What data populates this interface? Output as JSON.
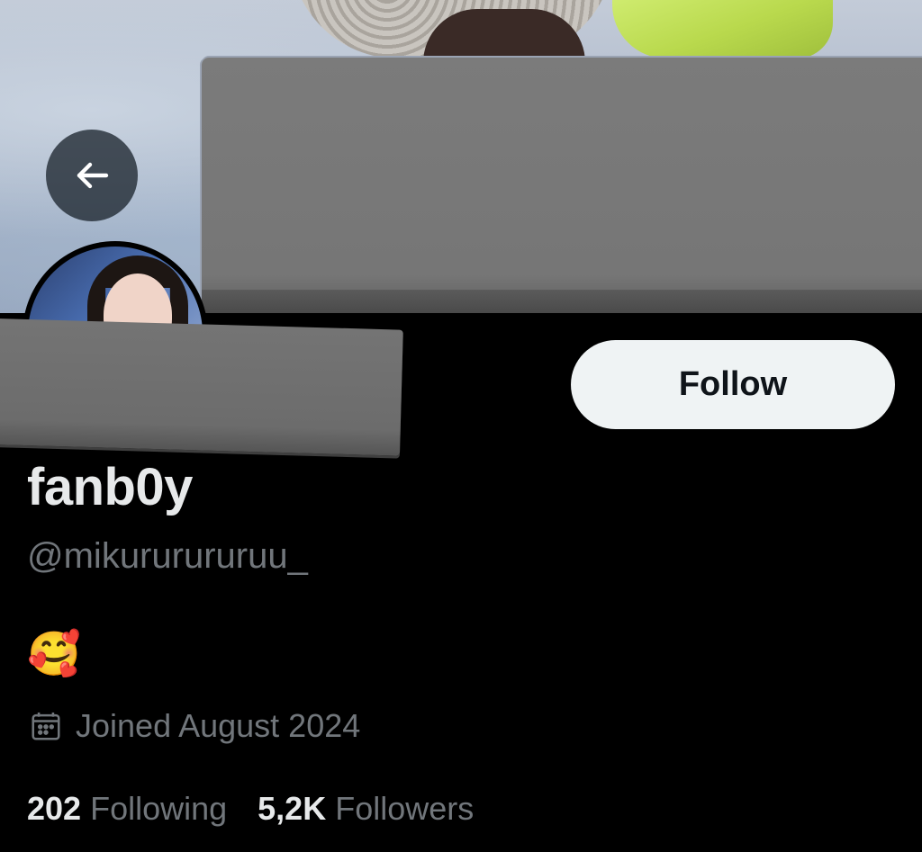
{
  "profile": {
    "display_name": "fanb0y",
    "handle": "@mikururururuu_",
    "bio": "🥰",
    "joined": "Joined August 2024"
  },
  "actions": {
    "follow_label": "Follow"
  },
  "stats": {
    "following_count": "202",
    "following_label": "Following",
    "followers_count": "5,2K",
    "followers_label": "Followers"
  },
  "icons": {
    "back": "back-arrow-icon",
    "calendar": "calendar-icon"
  },
  "colors": {
    "background": "#000000",
    "primary_text": "#e7e9ea",
    "secondary_text": "#71767b",
    "follow_button_bg": "#eff3f4",
    "follow_button_text": "#0f1419"
  }
}
